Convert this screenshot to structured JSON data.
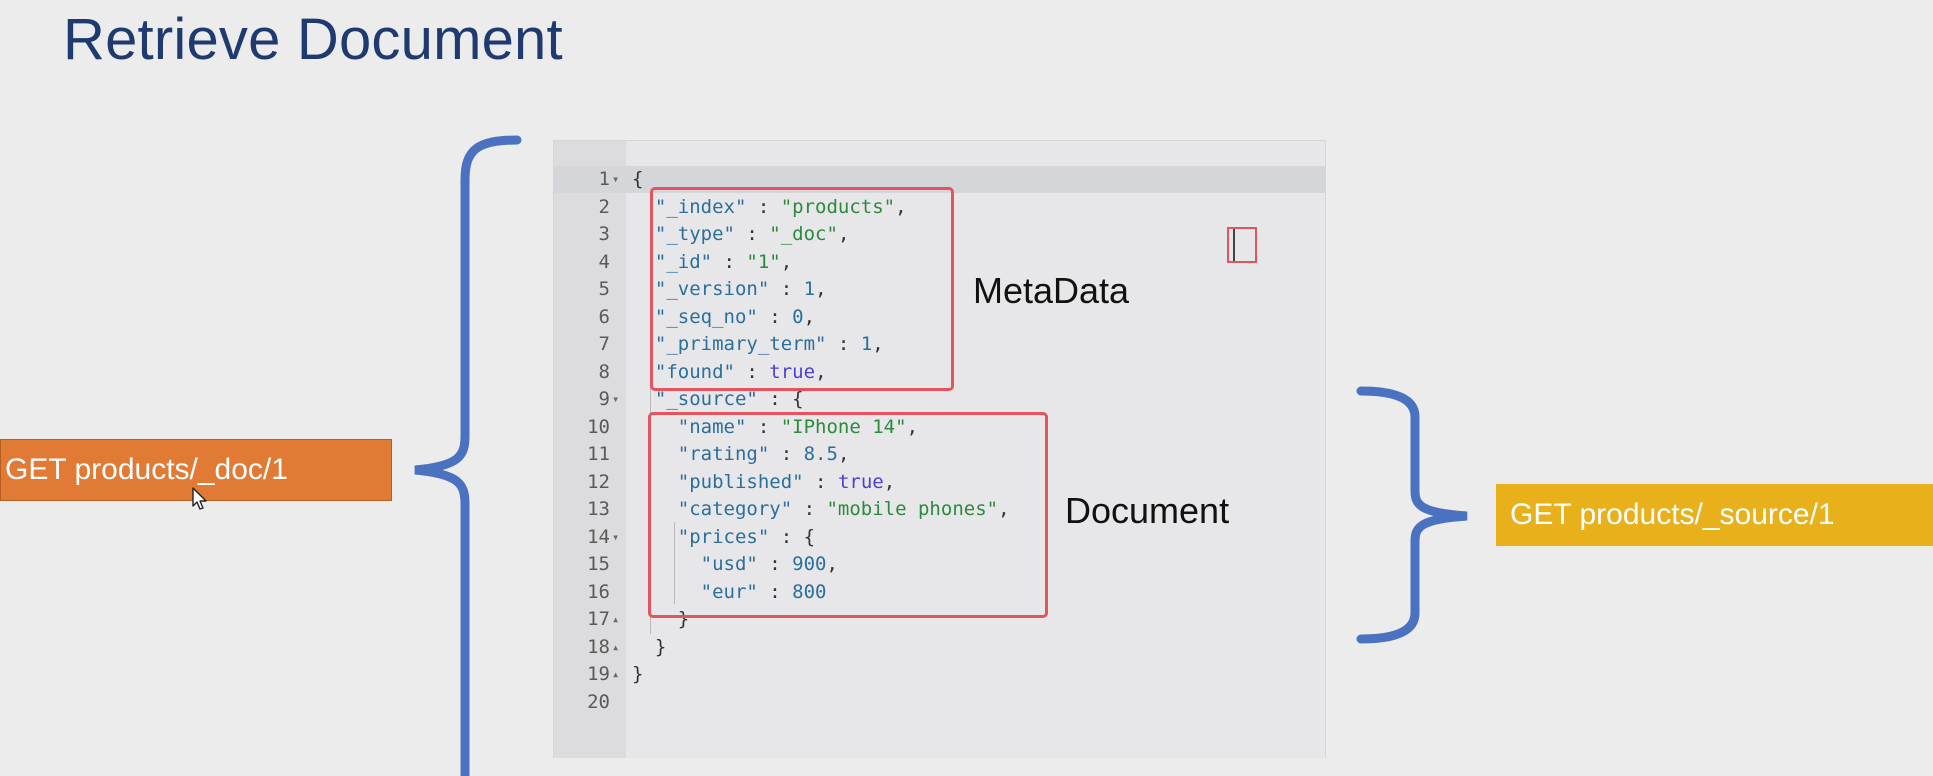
{
  "slide": {
    "title": "Retrieve Document"
  },
  "editor": {
    "lines": [
      {
        "n": "1",
        "fold": "▾",
        "tokens": [
          [
            "punc",
            "{"
          ]
        ]
      },
      {
        "n": "2",
        "fold": "",
        "tokens": [
          [
            "punc",
            "  "
          ],
          [
            "key",
            "\"_index\""
          ],
          [
            "punc",
            " : "
          ],
          [
            "str",
            "\"products\""
          ],
          [
            "punc",
            ","
          ]
        ]
      },
      {
        "n": "3",
        "fold": "",
        "tokens": [
          [
            "punc",
            "  "
          ],
          [
            "key",
            "\"_type\""
          ],
          [
            "punc",
            " : "
          ],
          [
            "str",
            "\"_doc\""
          ],
          [
            "punc",
            ","
          ]
        ]
      },
      {
        "n": "4",
        "fold": "",
        "tokens": [
          [
            "punc",
            "  "
          ],
          [
            "key",
            "\"_id\""
          ],
          [
            "punc",
            " : "
          ],
          [
            "str",
            "\"1\""
          ],
          [
            "punc",
            ","
          ]
        ]
      },
      {
        "n": "5",
        "fold": "",
        "tokens": [
          [
            "punc",
            "  "
          ],
          [
            "key",
            "\"_version\""
          ],
          [
            "punc",
            " : "
          ],
          [
            "num",
            "1"
          ],
          [
            "punc",
            ","
          ]
        ]
      },
      {
        "n": "6",
        "fold": "",
        "tokens": [
          [
            "punc",
            "  "
          ],
          [
            "key",
            "\"_seq_no\""
          ],
          [
            "punc",
            " : "
          ],
          [
            "num",
            "0"
          ],
          [
            "punc",
            ","
          ]
        ]
      },
      {
        "n": "7",
        "fold": "",
        "tokens": [
          [
            "punc",
            "  "
          ],
          [
            "key",
            "\"_primary_term\""
          ],
          [
            "punc",
            " : "
          ],
          [
            "num",
            "1"
          ],
          [
            "punc",
            ","
          ]
        ]
      },
      {
        "n": "8",
        "fold": "",
        "tokens": [
          [
            "punc",
            "  "
          ],
          [
            "key",
            "\"found\""
          ],
          [
            "punc",
            " : "
          ],
          [
            "bool",
            "true"
          ],
          [
            "punc",
            ","
          ]
        ]
      },
      {
        "n": "9",
        "fold": "▾",
        "tokens": [
          [
            "punc",
            "  "
          ],
          [
            "key",
            "\"_source\""
          ],
          [
            "punc",
            " : {"
          ]
        ]
      },
      {
        "n": "10",
        "fold": "",
        "tokens": [
          [
            "punc",
            "    "
          ],
          [
            "key",
            "\"name\""
          ],
          [
            "punc",
            " : "
          ],
          [
            "str",
            "\"IPhone 14\""
          ],
          [
            "punc",
            ","
          ]
        ]
      },
      {
        "n": "11",
        "fold": "",
        "tokens": [
          [
            "punc",
            "    "
          ],
          [
            "key",
            "\"rating\""
          ],
          [
            "punc",
            " : "
          ],
          [
            "num",
            "8.5"
          ],
          [
            "punc",
            ","
          ]
        ]
      },
      {
        "n": "12",
        "fold": "",
        "tokens": [
          [
            "punc",
            "    "
          ],
          [
            "key",
            "\"published\""
          ],
          [
            "punc",
            " : "
          ],
          [
            "bool",
            "true"
          ],
          [
            "punc",
            ","
          ]
        ]
      },
      {
        "n": "13",
        "fold": "",
        "tokens": [
          [
            "punc",
            "    "
          ],
          [
            "key",
            "\"category\""
          ],
          [
            "punc",
            " : "
          ],
          [
            "str",
            "\"mobile phones\""
          ],
          [
            "punc",
            ","
          ]
        ]
      },
      {
        "n": "14",
        "fold": "▾",
        "tokens": [
          [
            "punc",
            "    "
          ],
          [
            "key",
            "\"prices\""
          ],
          [
            "punc",
            " : {"
          ]
        ]
      },
      {
        "n": "15",
        "fold": "",
        "tokens": [
          [
            "punc",
            "      "
          ],
          [
            "key",
            "\"usd\""
          ],
          [
            "punc",
            " : "
          ],
          [
            "num",
            "900"
          ],
          [
            "punc",
            ","
          ]
        ]
      },
      {
        "n": "16",
        "fold": "",
        "tokens": [
          [
            "punc",
            "      "
          ],
          [
            "key",
            "\"eur\""
          ],
          [
            "punc",
            " : "
          ],
          [
            "num",
            "800"
          ]
        ]
      },
      {
        "n": "17",
        "fold": "▴",
        "tokens": [
          [
            "punc",
            "    }"
          ]
        ]
      },
      {
        "n": "18",
        "fold": "▴",
        "tokens": [
          [
            "punc",
            "  }"
          ]
        ]
      },
      {
        "n": "19",
        "fold": "▴",
        "tokens": [
          [
            "punc",
            "}"
          ]
        ]
      },
      {
        "n": "20",
        "fold": "",
        "tokens": []
      }
    ]
  },
  "annotations": {
    "metadata_label": "MetaData",
    "document_label": "Document"
  },
  "requests": {
    "get_doc": "GET products/_doc/1",
    "get_source": "GET products/_source/1"
  },
  "colors": {
    "title": "#1f3a6e",
    "highlight_box": "#e4545f",
    "brace": "#4a72c0",
    "get_doc_bg": "#e07a34",
    "get_source_bg": "#e8b01a"
  }
}
